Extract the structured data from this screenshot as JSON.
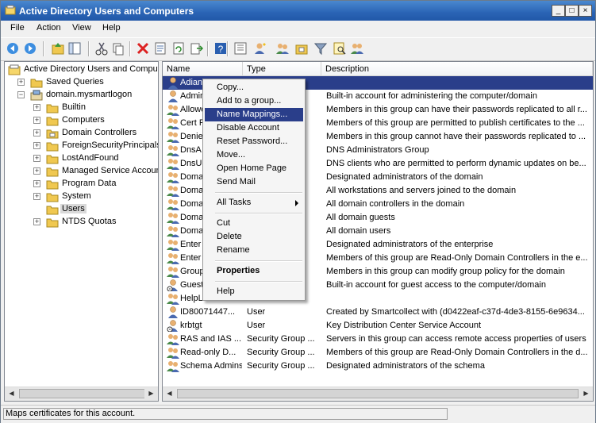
{
  "window": {
    "title": "Active Directory Users and Computers"
  },
  "menubar": [
    "File",
    "Action",
    "View",
    "Help"
  ],
  "toolbar": {
    "icons": [
      "back-icon",
      "forward-icon",
      "up-icon",
      "show-hide-tree-icon",
      "cut-icon",
      "copy-icon",
      "delete-icon",
      "properties-icon",
      "refresh-icon",
      "export-icon",
      "help-icon",
      "find-icon",
      "new-user-icon",
      "new-group-icon",
      "new-ou-icon",
      "filter-icon",
      "find-objects-icon",
      "add-to-group-icon"
    ]
  },
  "tree": [
    {
      "label": "Active Directory Users and Comput",
      "level": 0,
      "exp": "",
      "icon": "ad-root-icon"
    },
    {
      "label": "Saved Queries",
      "level": 1,
      "exp": "+",
      "icon": "folder-icon"
    },
    {
      "label": "domain.mysmartlogon",
      "level": 1,
      "exp": "-",
      "icon": "domain-icon"
    },
    {
      "label": "Builtin",
      "level": 2,
      "exp": "+",
      "icon": "folder-icon"
    },
    {
      "label": "Computers",
      "level": 2,
      "exp": "+",
      "icon": "folder-icon"
    },
    {
      "label": "Domain Controllers",
      "level": 2,
      "exp": "+",
      "icon": "ou-icon"
    },
    {
      "label": "ForeignSecurityPrincipals",
      "level": 2,
      "exp": "+",
      "icon": "folder-icon"
    },
    {
      "label": "LostAndFound",
      "level": 2,
      "exp": "+",
      "icon": "folder-icon"
    },
    {
      "label": "Managed Service Accounts",
      "level": 2,
      "exp": "+",
      "icon": "folder-icon"
    },
    {
      "label": "Program Data",
      "level": 2,
      "exp": "+",
      "icon": "folder-icon"
    },
    {
      "label": "System",
      "level": 2,
      "exp": "+",
      "icon": "folder-icon"
    },
    {
      "label": "Users",
      "level": 2,
      "exp": "",
      "icon": "folder-icon",
      "selected": true
    },
    {
      "label": "NTDS Quotas",
      "level": 2,
      "exp": "+",
      "icon": "folder-icon"
    }
  ],
  "list": {
    "columns": [
      "Name",
      "Type",
      "Description"
    ],
    "rows": [
      {
        "name": "Adian",
        "type": "",
        "desc": "",
        "icon": "user",
        "selected": true
      },
      {
        "name": "Admin",
        "type": "",
        "desc": "Built-in account for administering the computer/domain",
        "icon": "user"
      },
      {
        "name": "Allowe",
        "type": "",
        "desc": "Members in this group can have their passwords replicated to all r...",
        "icon": "group"
      },
      {
        "name": "Cert P",
        "type": "",
        "desc": "Members of this group are permitted to publish certificates to the ...",
        "icon": "group"
      },
      {
        "name": "Denie",
        "type": "",
        "desc": "Members in this group cannot have their passwords replicated to ...",
        "icon": "group"
      },
      {
        "name": "DnsA",
        "type": "",
        "desc": "DNS Administrators Group",
        "icon": "group"
      },
      {
        "name": "DnsU",
        "type": "",
        "desc": "DNS clients who are permitted to perform dynamic updates on be...",
        "icon": "group"
      },
      {
        "name": "Doma",
        "type": "",
        "desc": "Designated administrators of the domain",
        "icon": "group"
      },
      {
        "name": "Doma",
        "type": "",
        "desc": "All workstations and servers joined to the domain",
        "icon": "group"
      },
      {
        "name": "Doma",
        "type": "",
        "desc": "All domain controllers in the domain",
        "icon": "group"
      },
      {
        "name": "Doma",
        "type": "",
        "desc": "All domain guests",
        "icon": "group"
      },
      {
        "name": "Doma",
        "type": "",
        "desc": "All domain users",
        "icon": "group"
      },
      {
        "name": "Enter",
        "type": "",
        "desc": "Designated administrators of the enterprise",
        "icon": "group"
      },
      {
        "name": "Enter",
        "type": "",
        "desc": "Members of this group are Read-Only Domain Controllers in the e...",
        "icon": "group"
      },
      {
        "name": "Group",
        "type": "",
        "desc": "Members in this group can modify group policy for the domain",
        "icon": "group"
      },
      {
        "name": "Guest",
        "type": "",
        "desc": "Built-in account for guest access to the computer/domain",
        "icon": "user-disabled"
      },
      {
        "name": "HelpL",
        "type": "",
        "desc": "",
        "icon": "group"
      },
      {
        "name": "ID80071447...",
        "type": "User",
        "desc": "Created by Smartcollect with (d0422eaf-c37d-4de3-8155-6e9634...",
        "icon": "user"
      },
      {
        "name": "krbtgt",
        "type": "User",
        "desc": "Key Distribution Center Service Account",
        "icon": "user-disabled"
      },
      {
        "name": "RAS and IAS ...",
        "type": "Security Group ...",
        "desc": "Servers in this group can access remote access properties of users",
        "icon": "group"
      },
      {
        "name": "Read-only D...",
        "type": "Security Group ...",
        "desc": "Members of this group are Read-Only Domain Controllers in the d...",
        "icon": "group"
      },
      {
        "name": "Schema Admins",
        "type": "Security Group ...",
        "desc": "Designated administrators of the schema",
        "icon": "group"
      }
    ]
  },
  "context_menu": {
    "items": [
      {
        "label": "Copy...",
        "kind": "item"
      },
      {
        "label": "Add to a group...",
        "kind": "item"
      },
      {
        "label": "Name Mappings...",
        "kind": "item",
        "highlighted": true
      },
      {
        "label": "Disable Account",
        "kind": "item"
      },
      {
        "label": "Reset Password...",
        "kind": "item"
      },
      {
        "label": "Move...",
        "kind": "item"
      },
      {
        "label": "Open Home Page",
        "kind": "item"
      },
      {
        "label": "Send Mail",
        "kind": "item"
      },
      {
        "kind": "sep"
      },
      {
        "label": "All Tasks",
        "kind": "item",
        "submenu": true
      },
      {
        "kind": "sep"
      },
      {
        "label": "Cut",
        "kind": "item"
      },
      {
        "label": "Delete",
        "kind": "item"
      },
      {
        "label": "Rename",
        "kind": "item"
      },
      {
        "kind": "sep"
      },
      {
        "label": "Properties",
        "kind": "item",
        "bold": true
      },
      {
        "kind": "sep"
      },
      {
        "label": "Help",
        "kind": "item"
      }
    ]
  },
  "status": {
    "text": "Maps certificates for this account."
  },
  "colors": {
    "selection": "#2a3e8a",
    "title": "#2a64b5"
  }
}
